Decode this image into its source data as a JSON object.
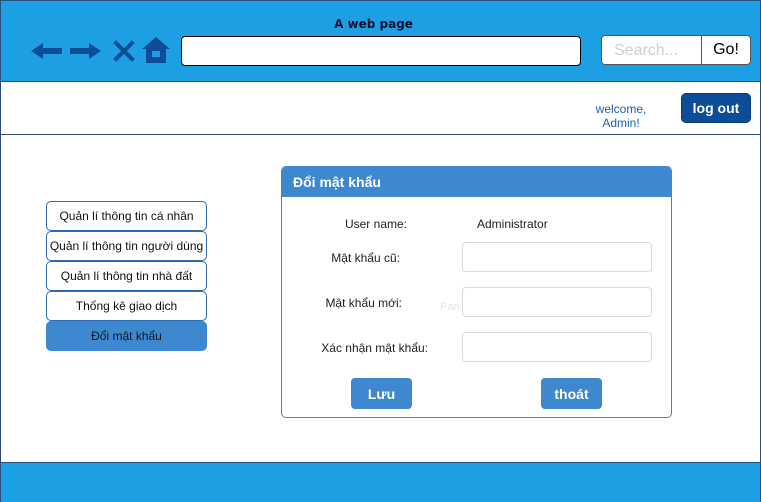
{
  "browser": {
    "title": "A web page",
    "search_placeholder": "Search...",
    "go_label": "Go!",
    "icon_color": "#0d4c96",
    "bar_color": "#1ca0e3",
    "icons": [
      "back-arrow-icon",
      "forward-arrow-icon",
      "close-icon",
      "home-icon"
    ]
  },
  "header": {
    "welcome_line1": "welcome,",
    "welcome_line2": "Admin!",
    "logout_label": "log out"
  },
  "sidebar": {
    "items": [
      {
        "label": "Quản lí thông tin cá nhân",
        "active": false
      },
      {
        "label": "Quản lí thông tin người dùng",
        "active": false
      },
      {
        "label": "Quản lí thông tin nhà đất",
        "active": false
      },
      {
        "label": "Thống kê giao dịch",
        "active": false
      },
      {
        "label": "Đổi mật khẩu",
        "active": true
      }
    ]
  },
  "panel": {
    "title": "Đổi mật khẩu",
    "username_label": "User name:",
    "username_value": "Administrator",
    "old_password_label": "Mật khẩu cũ:",
    "new_password_label": "Mật khẩu mới:",
    "confirm_password_label": "Xác nhận mật khẩu:",
    "ghost_text": "Pan",
    "save_label": "Lưu",
    "exit_label": "thoát",
    "accent_color": "#3d88cf"
  }
}
